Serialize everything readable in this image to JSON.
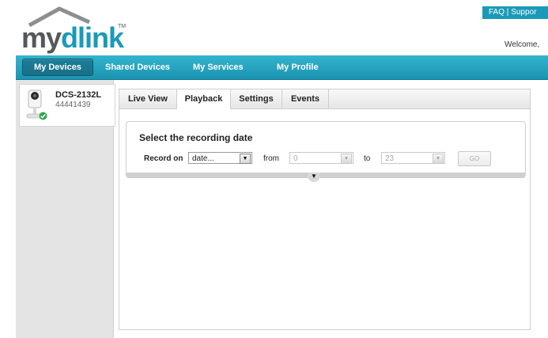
{
  "header": {
    "logo_my": "my",
    "logo_dlink": "dlink",
    "logo_tm": "TM",
    "faq_link": "FAQ",
    "separator": "|",
    "support_link": "Suppor",
    "welcome": "Welcome,"
  },
  "nav": {
    "items": [
      {
        "label": "My Devices",
        "active": true
      },
      {
        "label": "Shared Devices"
      },
      {
        "label": "My Services"
      },
      {
        "label": "My Profile"
      }
    ]
  },
  "device": {
    "name": "DCS-2132L",
    "id": "44441439",
    "status_icon": "check-circle-icon"
  },
  "tabs": [
    {
      "label": "Live View"
    },
    {
      "label": "Playback",
      "active": true
    },
    {
      "label": "Settings"
    },
    {
      "label": "Events"
    }
  ],
  "recording": {
    "title": "Select the recording date",
    "record_on_label": "Record on",
    "date_value": "date...",
    "from_label": "from",
    "from_value": "0",
    "to_label": "to",
    "to_value": "23",
    "go_label": "GO"
  },
  "colors": {
    "accent": "#1a9ab8",
    "nav_active": "#1c7f99",
    "status_green": "#2fa84f"
  }
}
